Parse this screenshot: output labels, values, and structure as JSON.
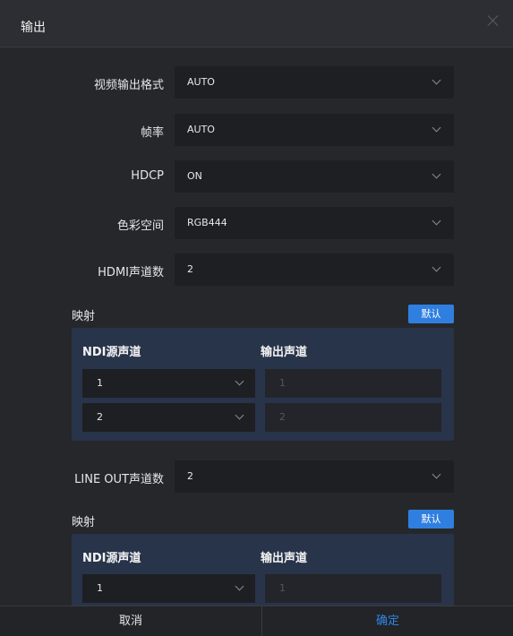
{
  "dialog": {
    "title": "输出"
  },
  "settings": {
    "video_format": {
      "label": "视频输出格式",
      "value": "AUTO"
    },
    "frame_rate": {
      "label": "帧率",
      "value": "AUTO"
    },
    "hdcp": {
      "label": "HDCP",
      "value": "ON"
    },
    "color_space": {
      "label": "色彩空间",
      "value": "RGB444"
    },
    "hdmi_channels": {
      "label": "HDMI声道数",
      "value": "2"
    },
    "lineout_channels": {
      "label": "LINE OUT声道数",
      "value": "2"
    }
  },
  "hdmi_mapping": {
    "title": "映射",
    "default_label": "默认",
    "src_header": "NDI源声道",
    "out_header": "输出声道",
    "rows": [
      {
        "src": "1",
        "out": "1"
      },
      {
        "src": "2",
        "out": "2"
      }
    ]
  },
  "lineout_mapping": {
    "title": "映射",
    "default_label": "默认",
    "src_header": "NDI源声道",
    "out_header": "输出声道",
    "rows": [
      {
        "src": "1",
        "out": "1"
      }
    ]
  },
  "footer": {
    "cancel": "取消",
    "ok": "确定"
  }
}
